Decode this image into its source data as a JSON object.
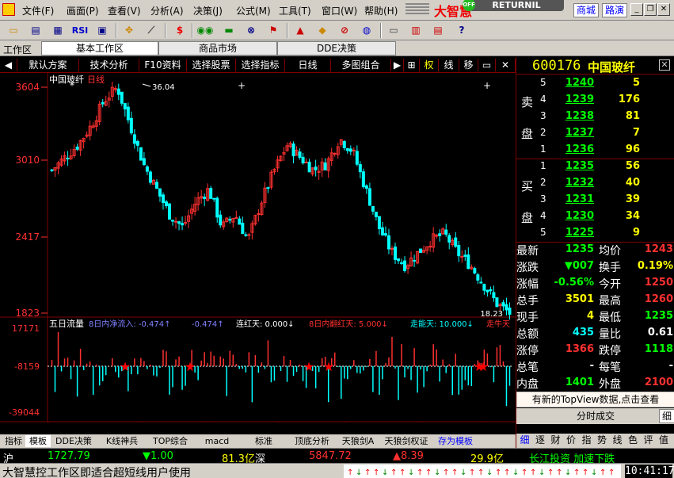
{
  "menubar": {
    "items": [
      "文件(F)",
      "画面(P)",
      "查看(V)",
      "分析(A)",
      "决策(J)",
      "公式(M)",
      "工具(T)",
      "窗口(W)",
      "帮助(H)"
    ],
    "logo_text": "大智慧",
    "returnil": "RETURNIL",
    "returnil_off": "OFF",
    "nav_market": "商城",
    "nav_roadshow": "路演"
  },
  "toolbar": {
    "icons": [
      "folder-icon",
      "chart-icon",
      "table-icon",
      "rsi-icon",
      "grid-icon",
      "crosshair-icon",
      "ruler-icon",
      "dollar-icon",
      "glasses-icon",
      "money-icon",
      "binoculars-icon",
      "flag-icon",
      "alert-icon",
      "diamond-icon",
      "stop-icon",
      "globe-icon",
      "notes-icon",
      "bars-icon",
      "list-icon",
      "help-icon"
    ],
    "rsi_label": "RSI",
    "dollar_label": "$"
  },
  "workspace": {
    "label": "工作区",
    "tabs": [
      "基本工作区",
      "商品市场",
      "DDE决策"
    ]
  },
  "chart_toolbar": {
    "items": [
      "默认方案",
      "技术分析",
      "F10资料",
      "选择股票",
      "选择指标",
      "日线",
      "多图组合"
    ],
    "right": [
      "权",
      "线",
      "移"
    ]
  },
  "chart": {
    "title": "中国玻纤",
    "period": "日线",
    "y_ticks": [
      "3604",
      "3010",
      "2417",
      "1823"
    ],
    "max_label": "36.04",
    "min_label": "18.23",
    "indicator_title": "五日流量",
    "indicator_labels": [
      "8日内净流入: -0.474↑",
      "-0.474↑",
      "连红天: 0.000↓",
      "8日内翻红天: 5.000↓",
      "走能天: 10.000↓",
      "走牛天"
    ],
    "ind_y_ticks": [
      "17171",
      "-8159",
      "-39044"
    ],
    "x_ticks": [
      "2008/02",
      "03",
      "04",
      "05",
      "06",
      "07",
      "08"
    ],
    "period_label": "日线"
  },
  "chart_data": {
    "type": "candlestick",
    "title": "中国玻纤 日线",
    "ylim": [
      1823,
      3604
    ],
    "xlabels": [
      "2008/02",
      "03",
      "04",
      "05",
      "06",
      "07",
      "08"
    ],
    "close_approx": [
      2950,
      3050,
      3150,
      3300,
      3500,
      3604,
      3300,
      3000,
      2800,
      2600,
      2500,
      2700,
      2800,
      2500,
      2600,
      2400,
      2700,
      2950,
      3150,
      3050,
      2950,
      3000,
      3200,
      3100,
      2800,
      2500,
      2300,
      2200,
      2300,
      2400,
      2450,
      2300,
      2200,
      2050,
      1900,
      1823
    ]
  },
  "buy_sell": {
    "sell_side": [
      "卖",
      "盘"
    ],
    "buy_side": [
      "买",
      "盘"
    ],
    "asks": [
      {
        "lvl": "5",
        "price": "1240",
        "vol": "5"
      },
      {
        "lvl": "4",
        "price": "1239",
        "vol": "176"
      },
      {
        "lvl": "3",
        "price": "1238",
        "vol": "81"
      },
      {
        "lvl": "2",
        "price": "1237",
        "vol": "7"
      },
      {
        "lvl": "1",
        "price": "1236",
        "vol": "96"
      }
    ],
    "bids": [
      {
        "lvl": "1",
        "price": "1235",
        "vol": "56"
      },
      {
        "lvl": "2",
        "price": "1232",
        "vol": "40"
      },
      {
        "lvl": "3",
        "price": "1231",
        "vol": "39"
      },
      {
        "lvl": "4",
        "price": "1230",
        "vol": "34"
      },
      {
        "lvl": "5",
        "price": "1225",
        "vol": "9"
      }
    ]
  },
  "stock": {
    "code": "600176",
    "name": "中国玻纤"
  },
  "quotes": [
    {
      "k1": "最新",
      "v1": "1235",
      "c1": "#00ff00",
      "k2": "均价",
      "v2": "1243",
      "c2": "#ff3030"
    },
    {
      "k1": "涨跌",
      "v1": "▼007",
      "c1": "#00ff00",
      "k2": "换手",
      "v2": "0.19%",
      "c2": "#ffff00"
    },
    {
      "k1": "涨幅",
      "v1": "-0.56%",
      "c1": "#00ff00",
      "k2": "今开",
      "v2": "1250",
      "c2": "#ff3030"
    },
    {
      "k1": "总手",
      "v1": "3501",
      "c1": "#ffff00",
      "k2": "最高",
      "v2": "1260",
      "c2": "#ff3030"
    },
    {
      "k1": "现手",
      "v1": "4",
      "c1": "#ffff00",
      "k2": "最低",
      "v2": "1235",
      "c2": "#00ff00"
    },
    {
      "k1": "总额",
      "v1": "435",
      "c1": "#00ffff",
      "k2": "量比",
      "v2": "0.61",
      "c2": "#ffffff"
    },
    {
      "k1": "涨停",
      "v1": "1366",
      "c1": "#ff3030",
      "k2": "跌停",
      "v2": "1118",
      "c2": "#00ff00"
    },
    {
      "k1": "总笔",
      "v1": "-",
      "c1": "#ffffff",
      "k2": "每笔",
      "v2": "-",
      "c2": "#ffffff"
    },
    {
      "k1": "内盘",
      "v1": "1401",
      "c1": "#00ff00",
      "k2": "外盘",
      "v2": "2100",
      "c2": "#ff3030"
    }
  ],
  "notice": "有新的TopView数据,点击查看",
  "fenshi": "分时成交",
  "fine_label": "细",
  "right_tabs": [
    "细",
    "逐",
    "财",
    "价",
    "指",
    "势",
    "线",
    "色",
    "评",
    "值"
  ],
  "bottom_tabs": [
    "指标",
    "模板",
    "DDE决策",
    "K线神兵",
    "TOP综合",
    "macd",
    "标准",
    "顶底分析",
    "天狼剑A",
    "天狼剑权证",
    "存为模板"
  ],
  "status1": {
    "sh_label": "沪",
    "sh_index": "1727.79",
    "sh_change": "▼1.00",
    "sh_amount": "81.3亿",
    "sz_label": "深",
    "sz_index": "5847.72",
    "sz_change": "▲8.39",
    "sz_amount": "29.9亿",
    "ticker": "长江投资 加速下跌"
  },
  "status2": {
    "message": "大智慧控工作区即适合超短线用户使用",
    "time": "10:41:17"
  },
  "colors": {
    "up": "#ff3030",
    "down": "#00ffff",
    "axis": "#800000"
  }
}
